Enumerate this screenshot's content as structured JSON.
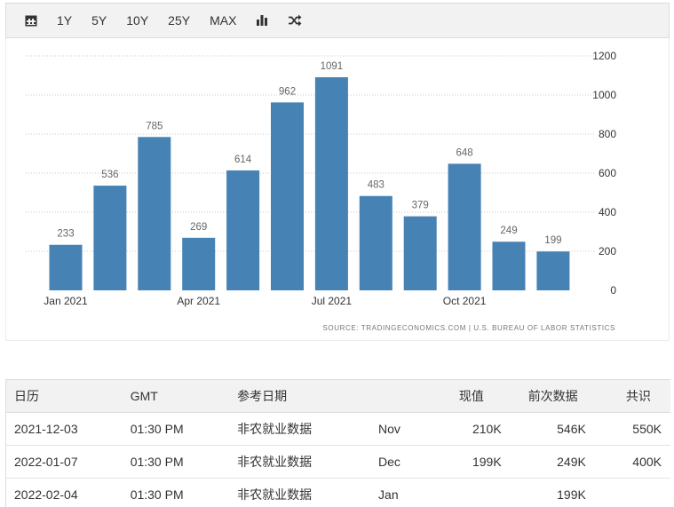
{
  "toolbar": {
    "calendar_icon": "calendar-icon",
    "ranges": [
      "1Y",
      "5Y",
      "10Y",
      "25Y",
      "MAX"
    ],
    "bar_chart_icon": "bar-chart-icon",
    "shuffle_icon": "shuffle-icon"
  },
  "chart_data": {
    "type": "bar",
    "categories": [
      "Jan 2021",
      "Feb 2021",
      "Mar 2021",
      "Apr 2021",
      "May 2021",
      "Jun 2021",
      "Jul 2021",
      "Aug 2021",
      "Sep 2021",
      "Oct 2021",
      "Nov 2021",
      "Dec 2021"
    ],
    "values": [
      233,
      536,
      785,
      269,
      614,
      962,
      1091,
      483,
      379,
      648,
      249,
      199
    ],
    "x_tick_labels": [
      {
        "category": "Jan 2021",
        "label": "Jan 2021"
      },
      {
        "category": "Apr 2021",
        "label": "Apr 2021"
      },
      {
        "category": "Jul 2021",
        "label": "Jul 2021"
      },
      {
        "category": "Oct 2021",
        "label": "Oct 2021"
      }
    ],
    "y_ticks": [
      0,
      200,
      400,
      600,
      800,
      1000,
      1200
    ],
    "ylim": [
      0,
      1200
    ],
    "y_axis_position": "right",
    "grid": true,
    "bar_color": "#4682b4",
    "source": "SOURCE: TRADINGECONOMICS.COM | U.S. BUREAU OF LABOR STATISTICS"
  },
  "table": {
    "headers": [
      "日历",
      "GMT",
      "参考日期",
      "",
      "现值",
      "前次数据",
      "共识"
    ],
    "rows": [
      [
        "2021-12-03",
        "01:30 PM",
        "非农就业数据",
        "Nov",
        "210K",
        "546K",
        "550K"
      ],
      [
        "2022-01-07",
        "01:30 PM",
        "非农就业数据",
        "Dec",
        "199K",
        "249K",
        "400K"
      ],
      [
        "2022-02-04",
        "01:30 PM",
        "非农就业数据",
        "Jan",
        "",
        "199K",
        ""
      ]
    ]
  }
}
